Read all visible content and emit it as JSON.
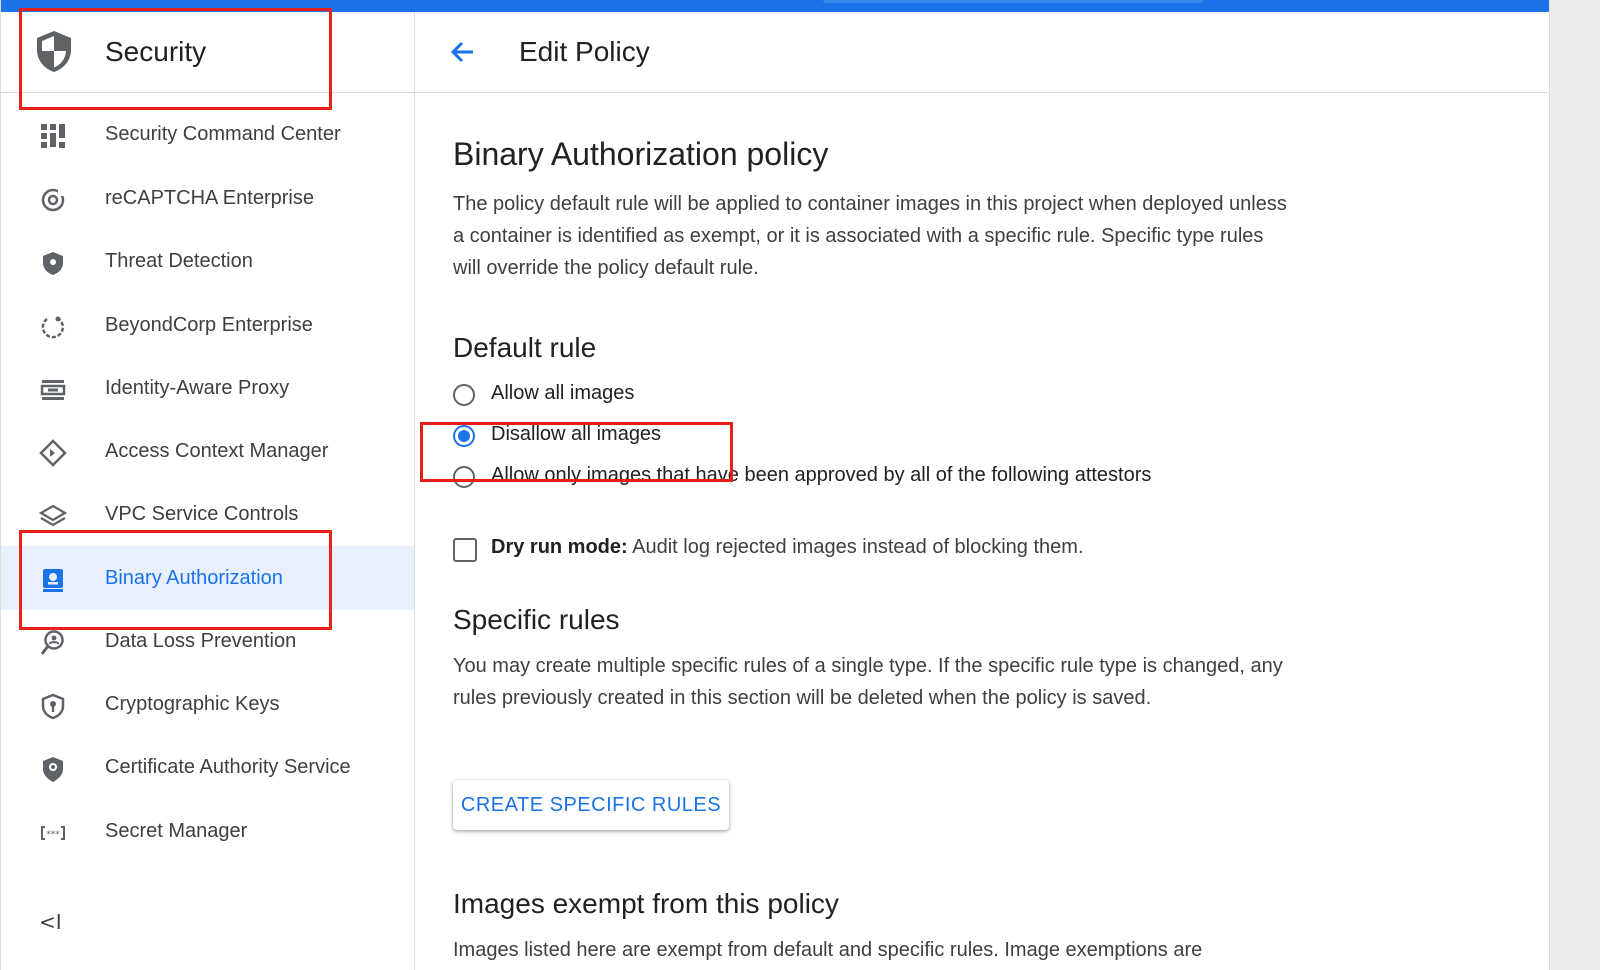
{
  "sidebar": {
    "title": "Security",
    "items": [
      {
        "label": "Security Command Center",
        "icon": "grid-dashboard-icon",
        "active": false
      },
      {
        "label": "reCAPTCHA Enterprise",
        "icon": "recaptcha-icon",
        "active": false
      },
      {
        "label": "Threat Detection",
        "icon": "shield-icon",
        "active": false
      },
      {
        "label": "BeyondCorp Enterprise",
        "icon": "circle-arrow-icon",
        "active": false
      },
      {
        "label": "Identity-Aware Proxy",
        "icon": "proxy-icon",
        "active": false
      },
      {
        "label": "Access Context Manager",
        "icon": "diamond-icon",
        "active": false
      },
      {
        "label": "VPC Service Controls",
        "icon": "layers-icon",
        "active": false
      },
      {
        "label": "Binary Authorization",
        "icon": "badge-icon",
        "active": true
      },
      {
        "label": "Data Loss Prevention",
        "icon": "magnifier-user-icon",
        "active": false
      },
      {
        "label": "Cryptographic Keys",
        "icon": "key-shield-icon",
        "active": false
      },
      {
        "label": "Certificate Authority Service",
        "icon": "certificate-icon",
        "active": false
      },
      {
        "label": "Secret Manager",
        "icon": "secret-brackets-icon",
        "active": false
      }
    ],
    "collapse_label": "<I"
  },
  "header": {
    "title": "Edit Policy"
  },
  "policy": {
    "heading": "Binary Authorization policy",
    "description": "The policy default rule will be applied to container images in this project when deployed unless a container is identified as exempt, or it is associated with a specific rule. Specific type rules will override the policy default rule."
  },
  "default_rule": {
    "heading": "Default rule",
    "options": [
      {
        "label": "Allow all images",
        "checked": false
      },
      {
        "label": "Disallow all images",
        "checked": true
      },
      {
        "label": "Allow only images that have been approved by all of the following attestors",
        "checked": false
      }
    ],
    "dry_run_bold": "Dry run mode:",
    "dry_run_text": " Audit log rejected images instead of blocking them.",
    "dry_run_checked": false
  },
  "specific_rules": {
    "heading": "Specific rules",
    "description": "You may create multiple specific rules of a single type. If the specific rule type is changed, any rules previously created in this section will be deleted when the policy is saved.",
    "button_label": "CREATE SPECIFIC RULES"
  },
  "exempt": {
    "heading": "Images exempt from this policy",
    "description": "Images listed here are exempt from default and specific rules. Image exemptions are"
  },
  "colors": {
    "accent": "#1a73e8",
    "annotation": "#e8201a",
    "active_bg": "#e8f0fe"
  }
}
